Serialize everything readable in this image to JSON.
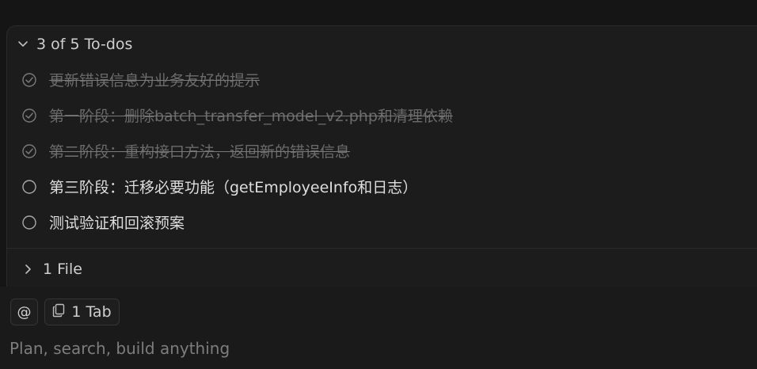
{
  "todos": {
    "summary": "3 of 5 To-dos",
    "items": [
      {
        "label": "更新错误信息为业务友好的提示",
        "status": "done"
      },
      {
        "label": "第一阶段：删除batch_transfer_model_v2.php和清理依赖",
        "status": "done"
      },
      {
        "label": "第二阶段：重构接口方法，返回新的错误信息",
        "status": "done"
      },
      {
        "label": "第三阶段：迁移必要功能（getEmployeeInfo和日志）",
        "status": "pending"
      },
      {
        "label": "测试验证和回滚预案",
        "status": "pending"
      }
    ]
  },
  "files": {
    "summary": "1 File"
  },
  "composer": {
    "mention_symbol": "@",
    "tab_label": "1 Tab",
    "placeholder": "Plan, search, build anything"
  },
  "icons": {
    "todos_toggle": "chevron-down-icon",
    "files_toggle": "chevron-right-icon",
    "done": "check-circle-icon",
    "pending": "empty-circle-icon",
    "tab": "copy-icon"
  },
  "colors": {
    "background": "#151515",
    "panel": "#1c1c1c",
    "text": "#dedede",
    "muted": "#6b6b6b",
    "placeholder": "#7d7d7d"
  }
}
